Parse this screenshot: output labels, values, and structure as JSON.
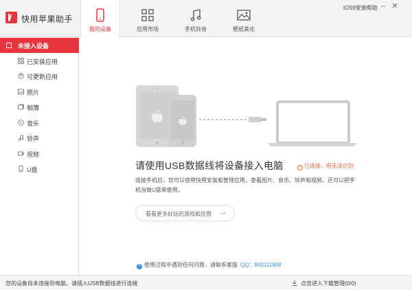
{
  "app": {
    "title": "快用苹果助手"
  },
  "nav": {
    "tabs": [
      {
        "label": "我的设备",
        "icon": "phone-icon"
      },
      {
        "label": "应用市场",
        "icon": "grid-icon"
      },
      {
        "label": "手机铃音",
        "icon": "music-note-icon"
      },
      {
        "label": "壁纸美化",
        "icon": "picture-icon"
      }
    ],
    "help_link": "iOS9安装帮助"
  },
  "sidebar": {
    "header": "未接入设备",
    "items": [
      {
        "label": "已安装应用",
        "icon": "apps-grid-icon"
      },
      {
        "label": "可更新应用",
        "icon": "update-icon"
      },
      {
        "label": "照片",
        "icon": "photo-icon"
      },
      {
        "label": "相簿",
        "icon": "album-icon"
      },
      {
        "label": "音乐",
        "icon": "music-icon"
      },
      {
        "label": "铃声",
        "icon": "bell-icon"
      },
      {
        "label": "视频",
        "icon": "video-icon"
      },
      {
        "label": "U盘",
        "icon": "usb-drive-icon"
      }
    ]
  },
  "main": {
    "headline": "请使用USB数据线将设备接入电脑",
    "status_note": "已连接，但无法识别",
    "description": "连接手机后，您可以使用快用安装和管理应用，查看图片、音乐、铃声和视频，还可以把手机当做U盘来使用。",
    "more_button": "看看更多好玩的游戏和应用",
    "help_text": "使用过程中遇到任何问题，请联系客服",
    "qq_label": "QQ：800111908"
  },
  "statusbar": {
    "left": "您的设备尚未连接到电脑，请插入USB数据线进行连接",
    "right": "点击进入下载管理(0/0)"
  },
  "colors": {
    "accent": "#e8343c",
    "link": "#3a8ee6",
    "warning": "#e8663c"
  }
}
